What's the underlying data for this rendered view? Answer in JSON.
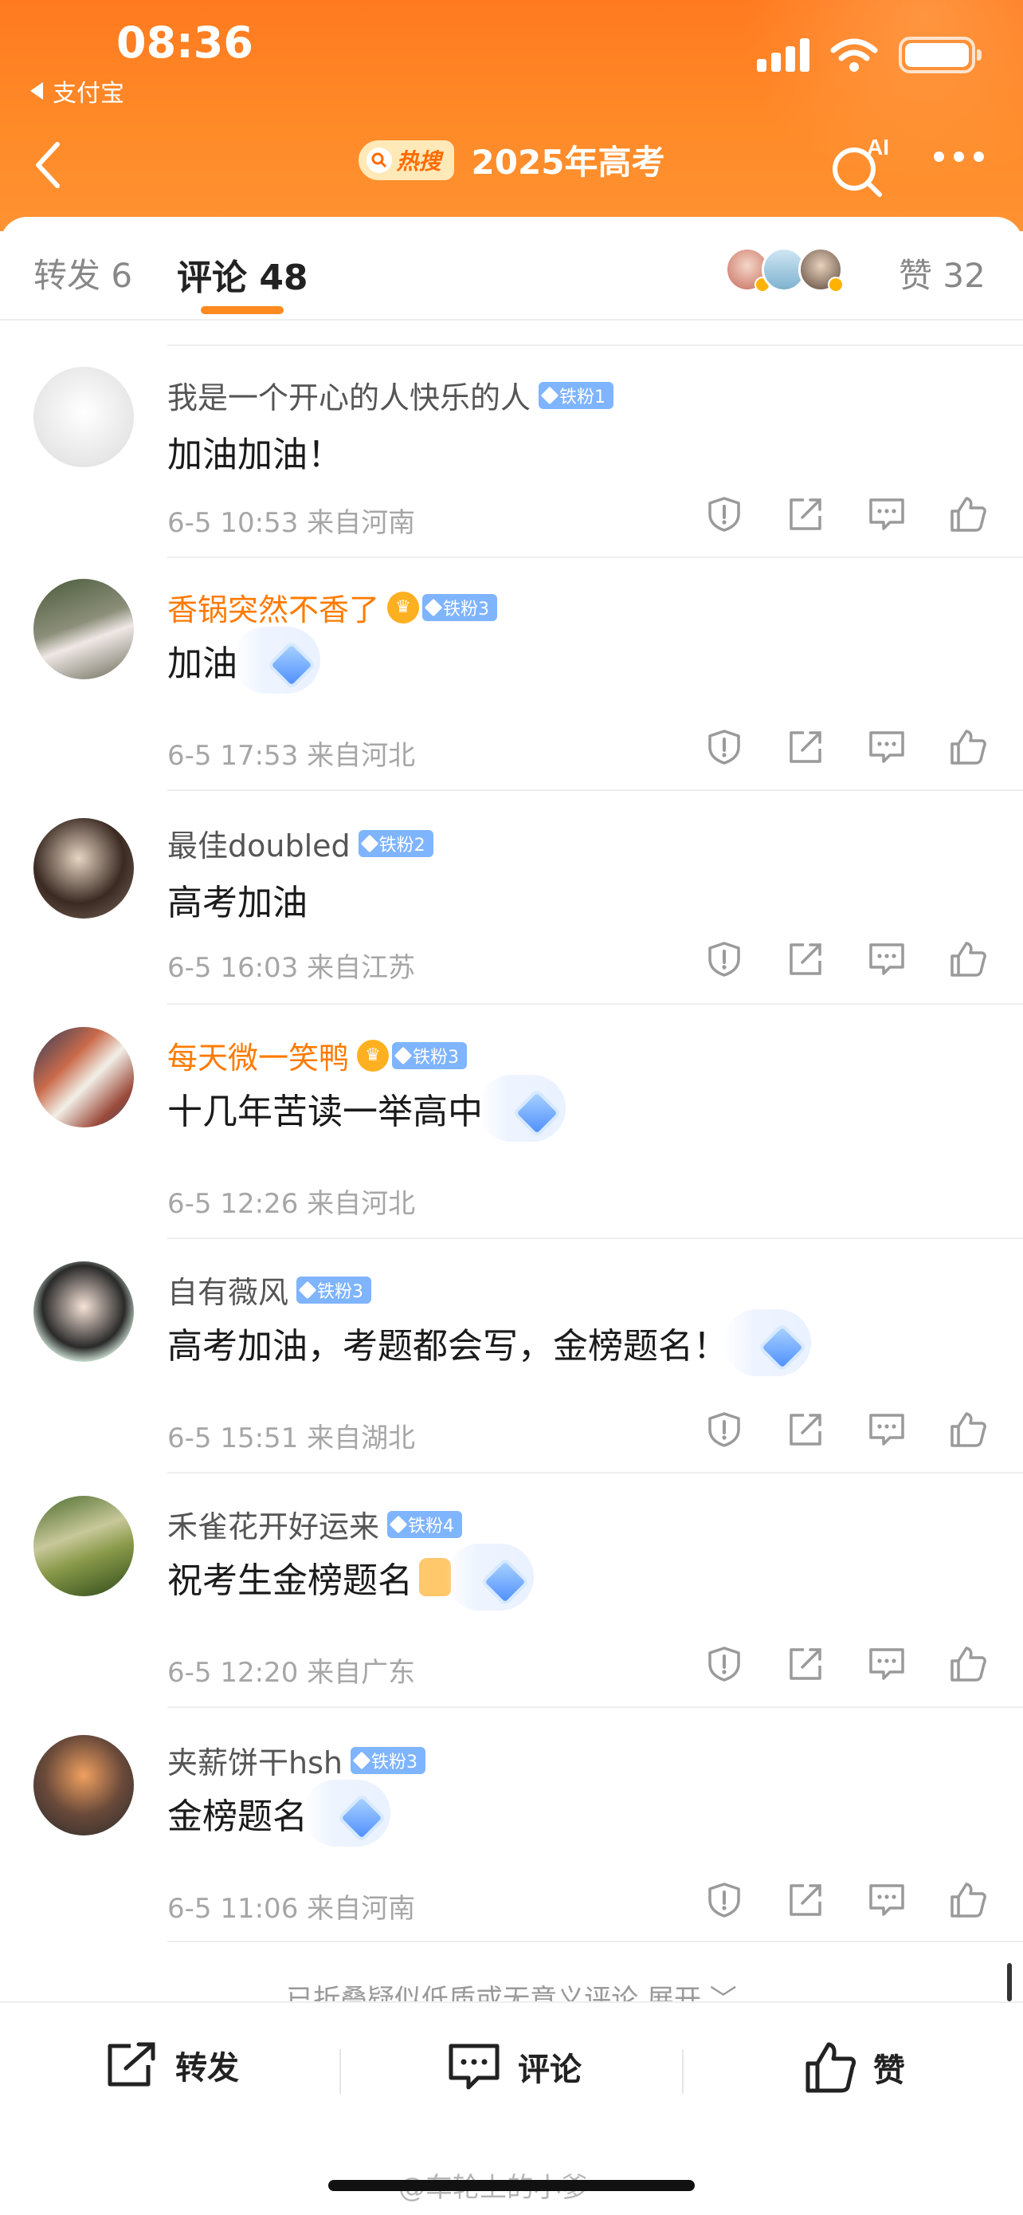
{
  "status_bar": {
    "time": "08:36",
    "back_app": "支付宝"
  },
  "nav": {
    "hot_badge": "热搜",
    "title": "2025年高考",
    "ai_label": "AI"
  },
  "tabs": {
    "forward": "转发 6",
    "comments": "评论 48",
    "likes": "赞 32"
  },
  "comments": [
    {
      "name": "我是一个开心的人快乐的人",
      "badge": "铁粉1",
      "text": "加油加油！",
      "meta": "6-5 10:53  来自河南"
    },
    {
      "name": "香锅突然不香了",
      "badge": "铁粉3",
      "text": "加油",
      "meta": "6-5 17:53  来自河北"
    },
    {
      "name": "最佳doubled",
      "badge": "铁粉2",
      "text": "高考加油",
      "meta": "6-5 16:03  来自江苏"
    },
    {
      "name": "每天微一笑鸭",
      "badge": "铁粉3",
      "text": "十几年苦读一举高中",
      "meta": "6-5 12:26  来自河北"
    },
    {
      "name": "自有薇风",
      "badge": "铁粉3",
      "text": "高考加油，考题都会写，金榜题名！",
      "meta": "6-5 15:51  来自湖北"
    },
    {
      "name": "禾雀花开好运来",
      "badge": "铁粉4",
      "text": "祝考生金榜题名",
      "meta": "6-5 12:20  来自广东"
    },
    {
      "name": "夹薪饼干hsh",
      "badge": "铁粉3",
      "text": "金榜题名",
      "meta": "6-5 11:06  来自河南"
    }
  ],
  "folded_notice": "已折叠疑似低质或无意义评论 展开 ﹀",
  "bottom_bar": {
    "forward": "转发",
    "comment": "评论",
    "like": "赞"
  },
  "watermark": "@车轮上的小爹",
  "colors": {
    "accent": "#ff7a1f",
    "fan_badge": "#7fb4ff",
    "vip_name": "#ff7a00"
  }
}
